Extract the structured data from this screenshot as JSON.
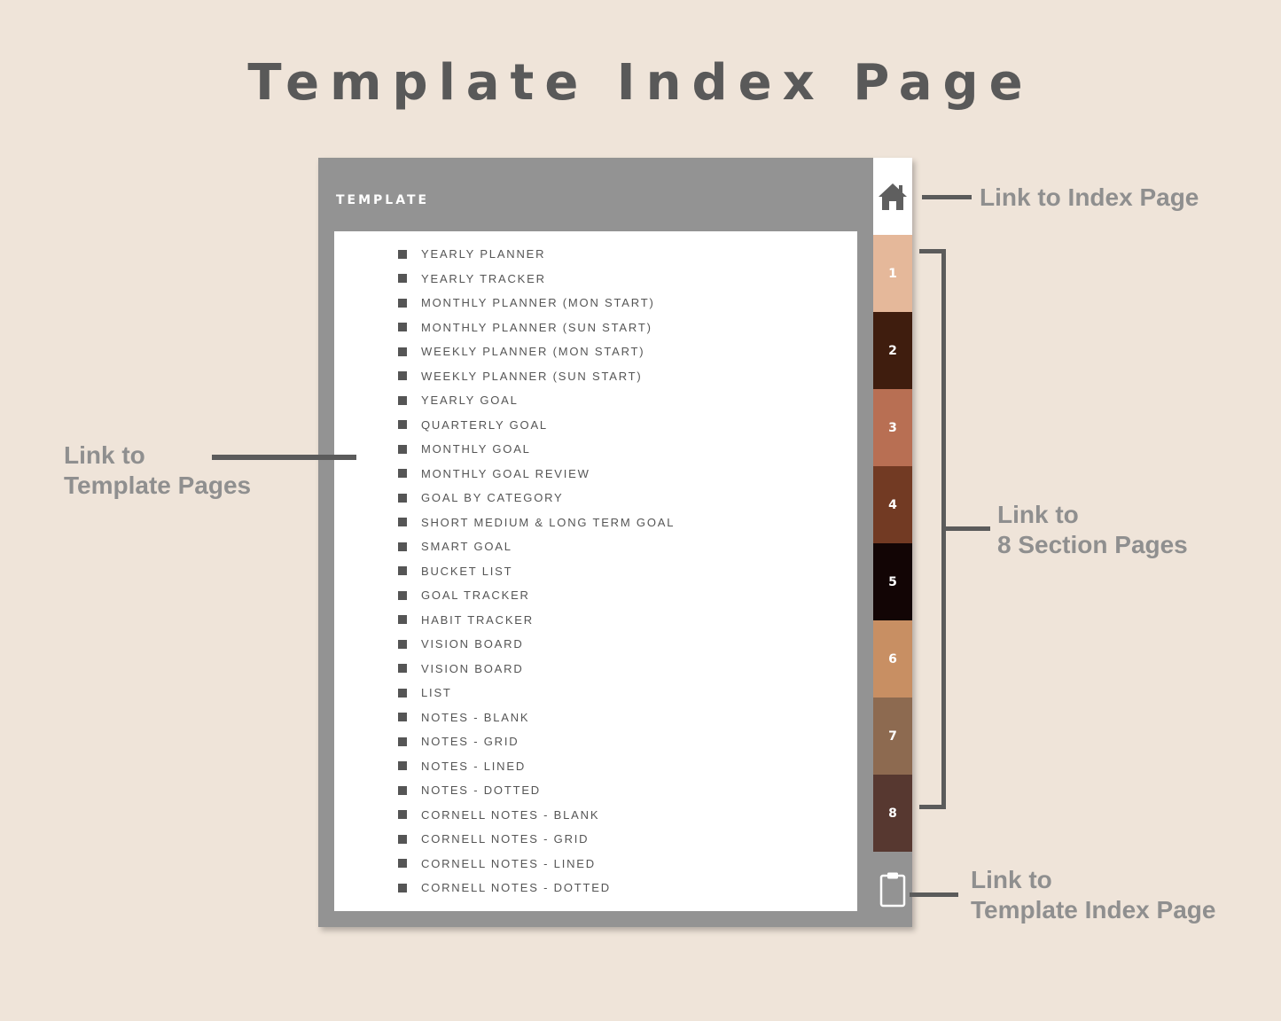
{
  "heading": "Template Index Page",
  "panel": {
    "title": "TEMPLATE",
    "items": [
      "YEARLY PLANNER",
      "YEARLY TRACKER",
      "MONTHLY PLANNER (MON START)",
      "MONTHLY PLANNER (SUN START)",
      "WEEKLY PLANNER (MON START)",
      "WEEKLY PLANNER (SUN START)",
      "YEARLY GOAL",
      "QUARTERLY GOAL",
      "MONTHLY GOAL",
      "MONTHLY GOAL REVIEW",
      "GOAL BY CATEGORY",
      "SHORT MEDIUM & LONG TERM GOAL",
      "SMART GOAL",
      "BUCKET LIST",
      "GOAL TRACKER",
      "HABIT TRACKER",
      "VISION BOARD",
      "VISION BOARD",
      "LIST",
      "NOTES - BLANK",
      "NOTES - GRID",
      "NOTES - LINED",
      "NOTES - DOTTED",
      "CORNELL NOTES - BLANK",
      "CORNELL NOTES - GRID",
      "CORNELL NOTES - LINED",
      "CORNELL NOTES - DOTTED"
    ]
  },
  "tabs": {
    "home_icon": "home-icon",
    "clipboard_icon": "clipboard-icon",
    "sections": [
      {
        "label": "1",
        "color": "#e5b89a"
      },
      {
        "label": "2",
        "color": "#3f1d0e"
      },
      {
        "label": "3",
        "color": "#b86f53"
      },
      {
        "label": "4",
        "color": "#723a23"
      },
      {
        "label": "5",
        "color": "#120505"
      },
      {
        "label": "6",
        "color": "#c88f63"
      },
      {
        "label": "7",
        "color": "#8d6a50"
      },
      {
        "label": "8",
        "color": "#573830"
      }
    ]
  },
  "callouts": {
    "index_page": {
      "line1": "Link to Index Page"
    },
    "template_pages": {
      "line1": "Link to",
      "line2": "Template Pages"
    },
    "section_pages": {
      "line1": "Link to",
      "line2": "8 Section Pages"
    },
    "template_index_page": {
      "line1": "Link to",
      "line2": "Template Index Page"
    }
  },
  "colors": {
    "background": "#efe4d9",
    "panel": "#939393",
    "callout_text": "#8f8f8f",
    "line": "#5b5b5b"
  }
}
